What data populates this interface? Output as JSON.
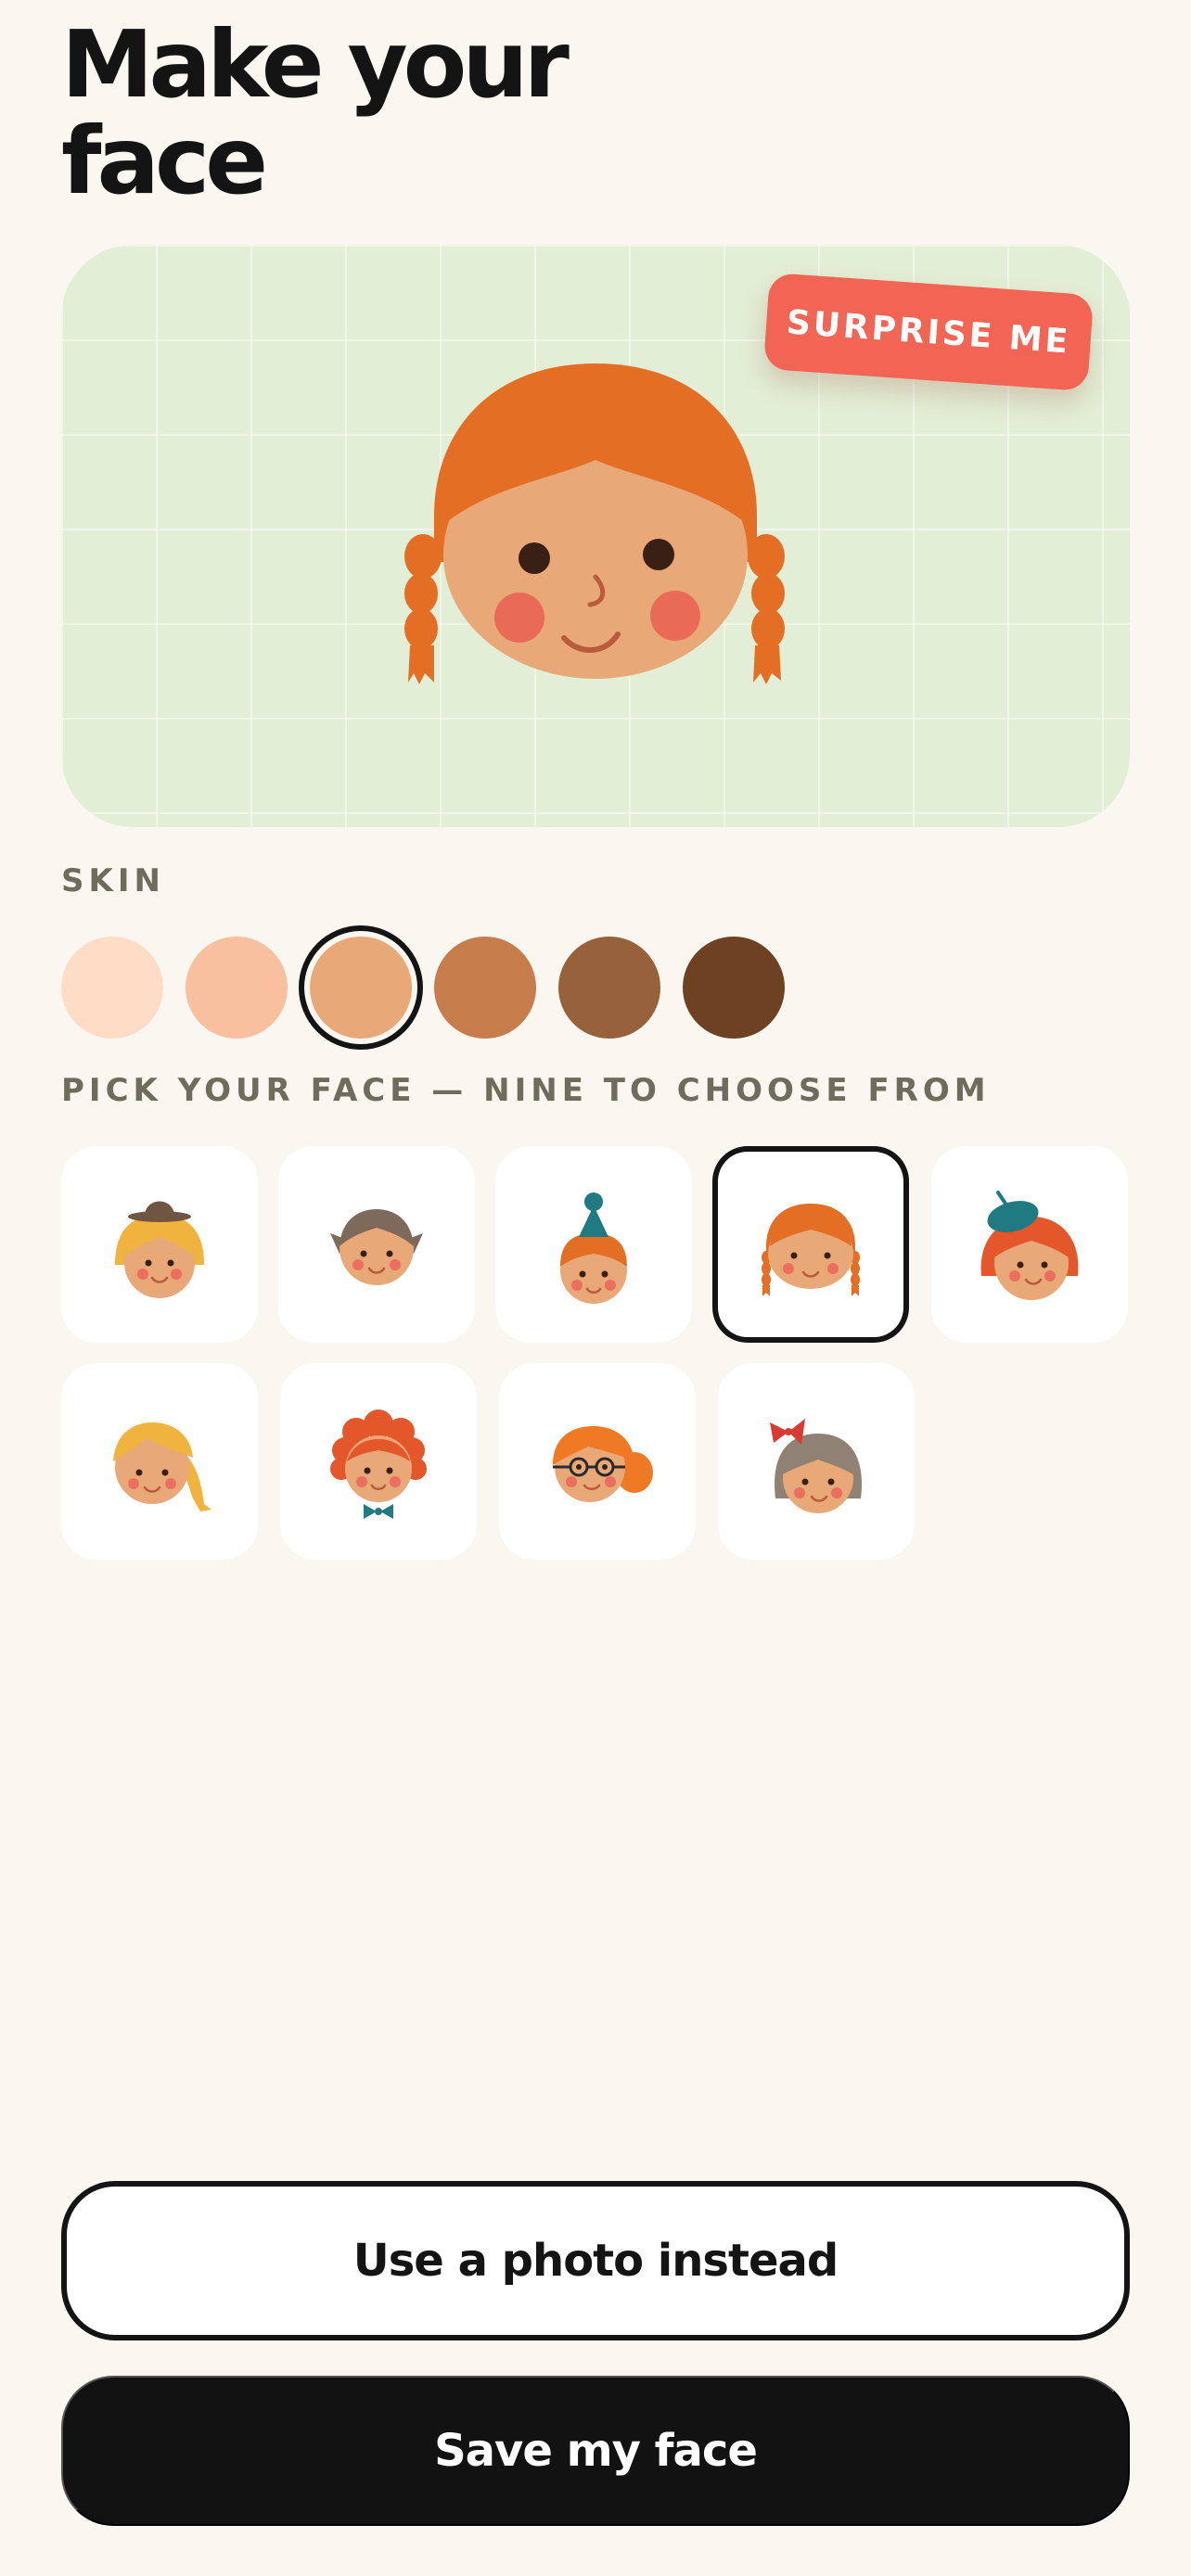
{
  "header": {
    "title_line1": "Make your",
    "title_line2": "face"
  },
  "preview": {
    "surprise_label": "SURPRISE ME"
  },
  "skin": {
    "label": "SKIN",
    "swatches": [
      "#ffdcc6",
      "#f8c09f",
      "#e8a877",
      "#c67d4b",
      "#97613b",
      "#6e4122"
    ],
    "selected_index": 2
  },
  "faces": {
    "label": "PICK YOUR FACE — NINE TO CHOOSE FROM",
    "options": [
      "bowler-hat-face",
      "pigtails-face",
      "party-hat-face",
      "braids-face",
      "beret-face",
      "side-ponytail-face",
      "curly-bowtie-face",
      "glasses-face",
      "bow-bob-face"
    ],
    "selected_index": 3
  },
  "actions": {
    "photo_label": "Use a photo instead",
    "save_label": "Save my face"
  },
  "colors": {
    "background": "#f9f7ef",
    "preview_bg": "#e2eed5",
    "accent": "#f26453",
    "ink": "#121212",
    "hair_orange": "#e36e24"
  }
}
